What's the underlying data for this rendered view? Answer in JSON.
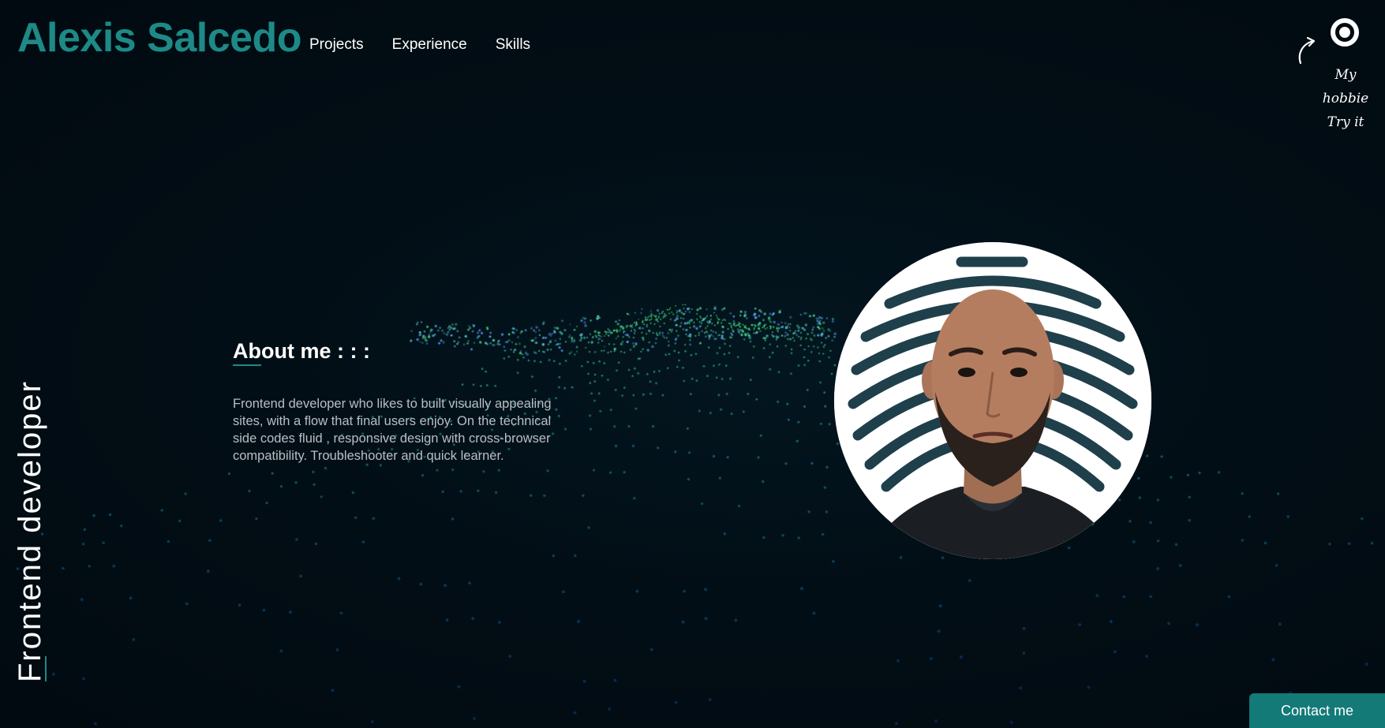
{
  "header": {
    "brand": "Alexis Salcedo",
    "nav": [
      {
        "label": "Projects"
      },
      {
        "label": "Experience"
      },
      {
        "label": "Skills"
      }
    ]
  },
  "hobbie": {
    "line1": "My hobbie",
    "line2": "Try it",
    "icon": "ring-icon"
  },
  "hero": {
    "vertical_title": "Frontend developer"
  },
  "about": {
    "heading": "About me : : :",
    "text": "Frontend developer who likes to built visually appealing sites, with a flow that final users enjoy. On the technical side codes fluid , responsive design with cross-browser compatibility. Troubleshooter and quick learner."
  },
  "contact": {
    "label": "Contact me"
  },
  "colors": {
    "background": "#020d14",
    "accent": "#1d8a87",
    "button": "#137a78",
    "text": "#ffffff",
    "muted_text": "#b8bfc4"
  }
}
